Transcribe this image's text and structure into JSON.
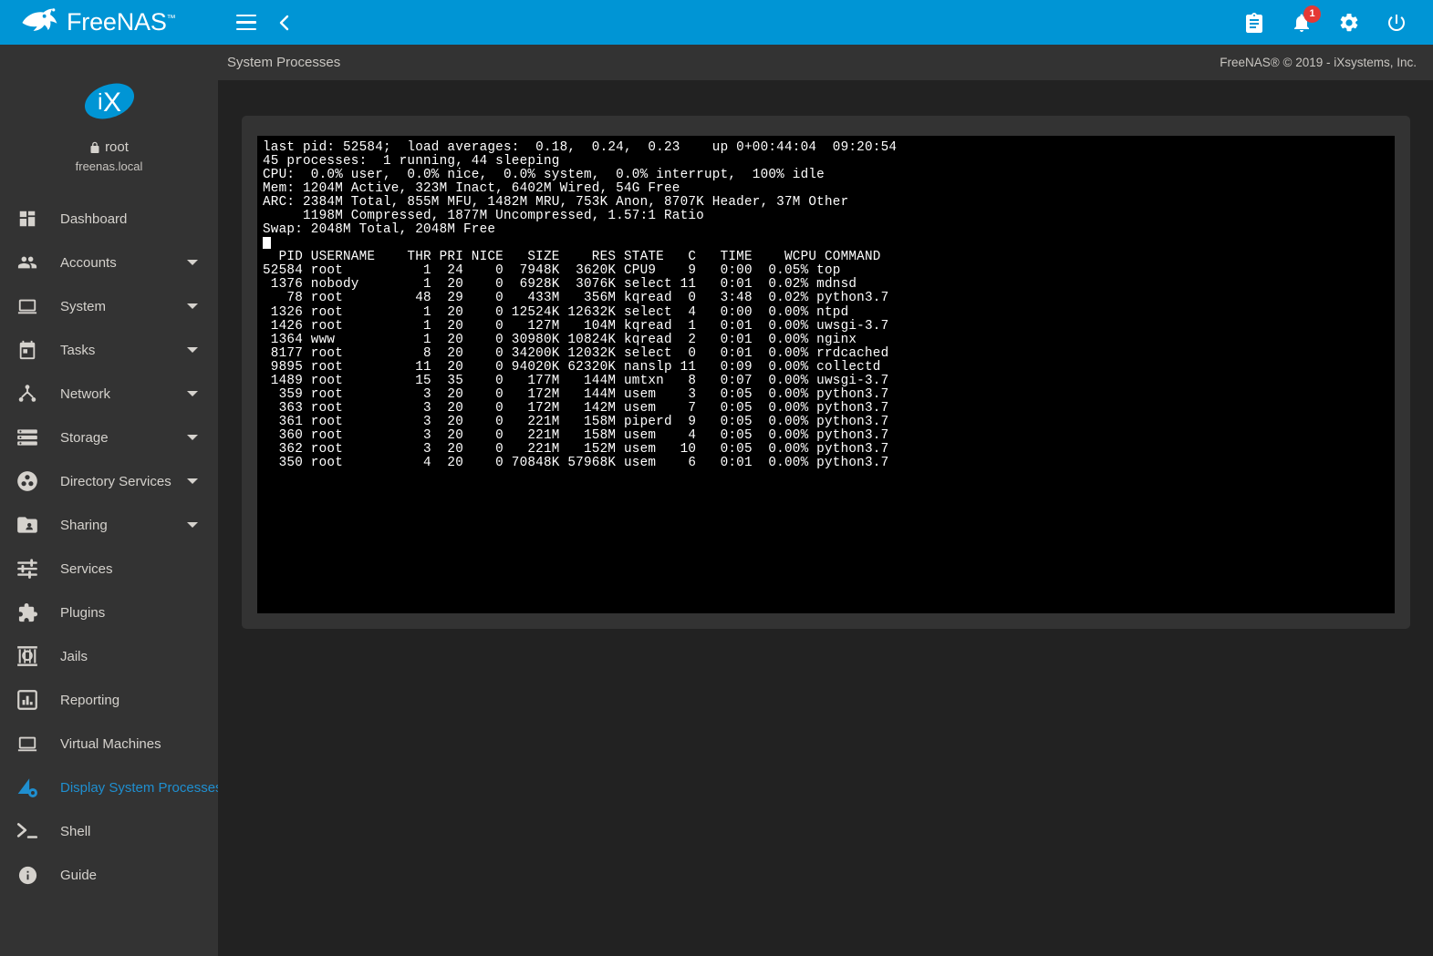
{
  "topbar": {
    "brand_name": "FreeNAS",
    "brand_tm": "™",
    "menu_toggle": "menu-icon",
    "collapse": "chevron-left-icon",
    "right_icons": [
      {
        "name": "task-manager-icon",
        "glyph": "clipboard"
      },
      {
        "name": "notifications-icon",
        "glyph": "bell",
        "badge": "1"
      },
      {
        "name": "settings-icon",
        "glyph": "gear"
      },
      {
        "name": "power-icon",
        "glyph": "power"
      }
    ]
  },
  "sidebar": {
    "logo_text": "iX",
    "username": "root",
    "hostname": "freenas.local",
    "items": [
      {
        "label": "Dashboard",
        "icon": "dashboard-icon",
        "caret": false,
        "active": false
      },
      {
        "label": "Accounts",
        "icon": "accounts-icon",
        "caret": true,
        "active": false
      },
      {
        "label": "System",
        "icon": "system-icon",
        "caret": true,
        "active": false
      },
      {
        "label": "Tasks",
        "icon": "tasks-icon",
        "caret": true,
        "active": false
      },
      {
        "label": "Network",
        "icon": "network-icon",
        "caret": true,
        "active": false
      },
      {
        "label": "Storage",
        "icon": "storage-icon",
        "caret": true,
        "active": false
      },
      {
        "label": "Directory Services",
        "icon": "directory-services-icon",
        "caret": true,
        "active": false
      },
      {
        "label": "Sharing",
        "icon": "sharing-icon",
        "caret": true,
        "active": false
      },
      {
        "label": "Services",
        "icon": "services-icon",
        "caret": false,
        "active": false
      },
      {
        "label": "Plugins",
        "icon": "plugins-icon",
        "caret": false,
        "active": false
      },
      {
        "label": "Jails",
        "icon": "jails-icon",
        "caret": false,
        "active": false
      },
      {
        "label": "Reporting",
        "icon": "reporting-icon",
        "caret": false,
        "active": false
      },
      {
        "label": "Virtual Machines",
        "icon": "virtual-machines-icon",
        "caret": false,
        "active": false
      },
      {
        "label": "Display System Processes",
        "icon": "processes-icon",
        "caret": false,
        "active": true
      },
      {
        "label": "Shell",
        "icon": "shell-icon",
        "caret": false,
        "active": false
      },
      {
        "label": "Guide",
        "icon": "guide-icon",
        "caret": false,
        "active": false
      }
    ]
  },
  "header": {
    "page_title": "System Processes",
    "copyright": "FreeNAS® © 2019 - iXsystems, Inc."
  },
  "terminal": {
    "summary_lines": [
      "last pid: 52584;  load averages:  0.18,  0.24,  0.23    up 0+00:44:04  09:20:54",
      "45 processes:  1 running, 44 sleeping",
      "CPU:  0.0% user,  0.0% nice,  0.0% system,  0.0% interrupt,  100% idle",
      "Mem: 1204M Active, 323M Inact, 6402M Wired, 54G Free",
      "ARC: 2384M Total, 855M MFU, 1482M MRU, 753K Anon, 8707K Header, 37M Other",
      "     1198M Compressed, 1877M Uncompressed, 1.57:1 Ratio",
      "Swap: 2048M Total, 2048M Free"
    ],
    "table_header": "  PID USERNAME    THR PRI NICE   SIZE    RES STATE   C   TIME    WCPU COMMAND",
    "rows": [
      "52584 root          1  24    0  7948K  3620K CPU9    9   0:00  0.05% top",
      " 1376 nobody        1  20    0  6928K  3076K select 11   0:01  0.02% mdnsd",
      "   78 root         48  29    0   433M   356M kqread  0   3:48  0.02% python3.7",
      " 1326 root          1  20    0 12524K 12632K select  4   0:00  0.00% ntpd",
      " 1426 root          1  20    0   127M   104M kqread  1   0:01  0.00% uwsgi-3.7",
      " 1364 www           1  20    0 30980K 10824K kqread  2   0:01  0.00% nginx",
      " 8177 root          8  20    0 34200K 12032K select  0   0:01  0.00% rrdcached",
      " 9895 root         11  20    0 94020K 62320K nanslp 11   0:09  0.00% collectd",
      " 1489 root         15  35    0   177M   144M umtxn   8   0:07  0.00% uwsgi-3.7",
      "  359 root          3  20    0   172M   144M usem    3   0:05  0.00% python3.7",
      "  363 root          3  20    0   172M   142M usem    7   0:05  0.00% python3.7",
      "  361 root          3  20    0   221M   158M piperd  9   0:05  0.00% python3.7",
      "  360 root          3  20    0   221M   158M usem    4   0:05  0.00% python3.7",
      "  362 root          3  20    0   221M   152M usem   10   0:05  0.00% python3.7",
      "  350 root          4  20    0 70848K 57968K usem    6   0:01  0.00% python3.7"
    ]
  },
  "colors": {
    "brand_blue": "#0095d5",
    "sidebar_bg": "#333333",
    "content_bg": "#222222",
    "active_blue": "#1f8fd0",
    "badge_red": "#e53935",
    "terminal_bg": "#000000",
    "terminal_fg": "#ffffff"
  }
}
